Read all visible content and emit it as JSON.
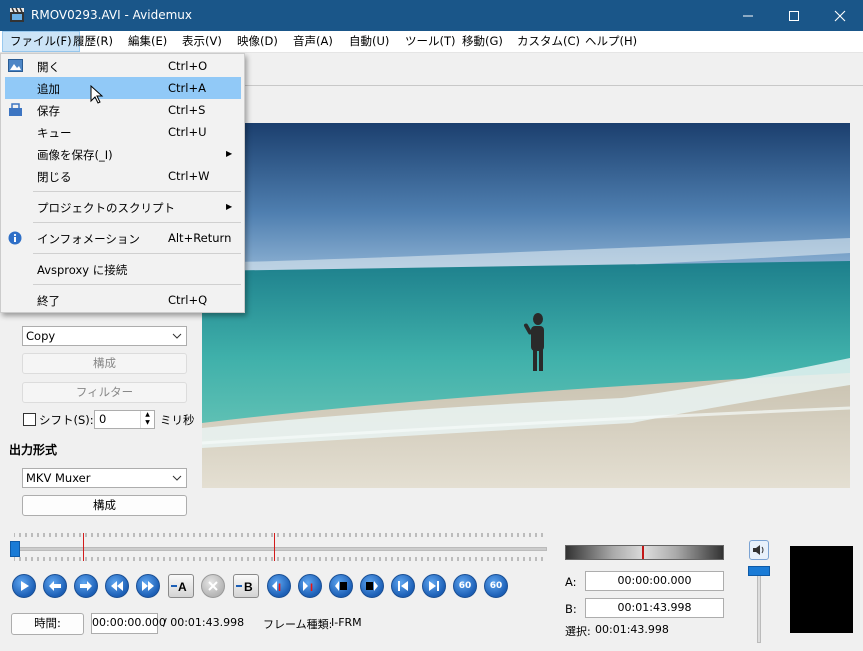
{
  "window": {
    "title": "RMOV0293.AVI - Avidemux",
    "app_icon": "clapperboard-icon"
  },
  "menubar": {
    "items": [
      "ファイル(F)",
      "履歴(R)",
      "編集(E)",
      "表示(V)",
      "映像(D)",
      "音声(A)",
      "自動(U)",
      "ツール(T)",
      "移動(G)",
      "カスタム(C)",
      "ヘルプ(H)"
    ]
  },
  "file_menu": {
    "items": [
      {
        "label": "開く",
        "shortcut": "Ctrl+O",
        "icon": "open-image-icon"
      },
      {
        "label": "追加",
        "shortcut": "Ctrl+A",
        "highlighted": true
      },
      {
        "label": "保存",
        "shortcut": "Ctrl+S",
        "icon": "save-bag-icon"
      },
      {
        "label": "キュー",
        "shortcut": "Ctrl+U"
      },
      {
        "label": "画像を保存(_I)",
        "shortcut": ""
      },
      {
        "label": "閉じる",
        "shortcut": "Ctrl+W"
      },
      {
        "label": "プロジェクトのスクリプト",
        "shortcut": ""
      },
      {
        "label": "インフォメーション",
        "shortcut": "Alt+Return",
        "icon": "info-icon"
      },
      {
        "label": "Avsproxy に接続",
        "shortcut": ""
      },
      {
        "label": "終了",
        "shortcut": "Ctrl+Q"
      }
    ]
  },
  "left_panel": {
    "video_codec": "Copy",
    "configure_label": "構成",
    "filter_label": "フィルター",
    "shift_label": "シフト(S):",
    "shift_value": "0",
    "shift_unit": "ミリ秒",
    "output_format_title": "出力形式",
    "muxer": "MKV Muxer",
    "muxer_configure_label": "構成"
  },
  "timeline": {
    "position_fraction": 0.0,
    "marker_a_fraction": 0.13,
    "marker_b_fraction": 0.49
  },
  "bottom": {
    "time_button_label": "時間:",
    "current_time": "00:00:00.000",
    "total_time": "/ 00:01:43.998",
    "frame_type_label": "フレーム種類:",
    "frame_type_value": "I-FRM"
  },
  "ab": {
    "a_label": "A:",
    "a_value": "00:00:00.000",
    "b_label": "B:",
    "b_value": "00:01:43.998",
    "selection_label": "選択:",
    "selection_value": "00:01:43.998"
  },
  "controls": {
    "buttons": [
      "play",
      "previous-frame",
      "next-frame",
      "rewind",
      "fast-forward",
      "set-marker-a",
      "reset-markers",
      "set-marker-b",
      "previous-intra",
      "next-intra",
      "previous-black",
      "next-black",
      "goto-first",
      "goto-last",
      "back-60",
      "forward-60"
    ],
    "back_60_label": "60",
    "forward_60_label": "60"
  },
  "volume": {
    "level": 0.0
  }
}
